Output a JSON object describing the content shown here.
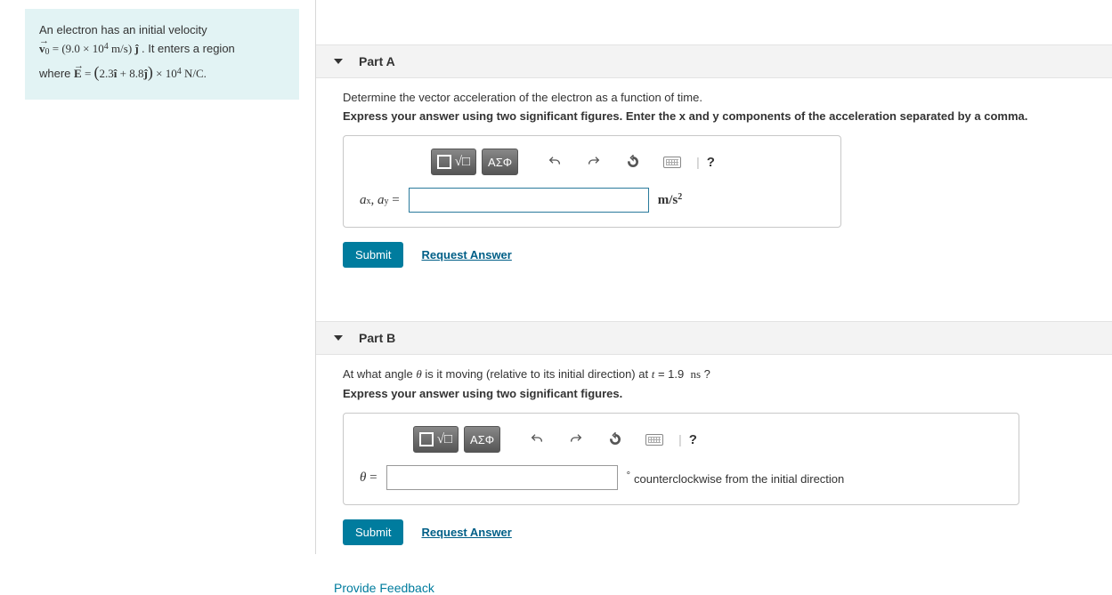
{
  "problem": {
    "line1": "An electron has an initial velocity",
    "v_label": "v",
    "v_sub": "0",
    "v_value": "9.0 × 10",
    "v_exp": "4",
    "v_unit": "m/s",
    "v_dir": "ĵ",
    "line2b": ". It enters a region",
    "line3a": "where ",
    "E_label": "E",
    "E_eq": " = ",
    "E_i": "2.3",
    "E_ihat": "î",
    "E_plus": " + ",
    "E_j": "8.8",
    "E_jhat": "ĵ",
    "E_mult": " × 10",
    "E_exp": "4",
    "E_unit": " N/C"
  },
  "partA": {
    "title": "Part A",
    "prompt": "Determine the vector acceleration of the electron as a function of time.",
    "instruction": "Express your answer using two significant figures. Enter the x and y components of the acceleration separated by a comma.",
    "eq_label_html": "aₓ, a_y =",
    "unit": "m/s",
    "unit_exp": "2",
    "submit": "Submit",
    "request": "Request Answer",
    "tool_greek": "ΑΣΦ",
    "tool_help": "?"
  },
  "partB": {
    "title": "Part B",
    "prompt_a": "At what angle ",
    "theta": "θ",
    "prompt_b": " is it moving (relative to its initial direction) at ",
    "t_label": "t",
    "t_eq": " = ",
    "t_val": "1.9",
    "t_unit": "ns",
    "prompt_c": " ?",
    "instruction": "Express your answer using two significant figures.",
    "eq_label": "θ =",
    "unit_deg": "°",
    "unit_text": "counterclockwise from the initial direction",
    "submit": "Submit",
    "request": "Request Answer",
    "tool_greek": "ΑΣΦ",
    "tool_help": "?"
  },
  "feedback": "Provide Feedback"
}
